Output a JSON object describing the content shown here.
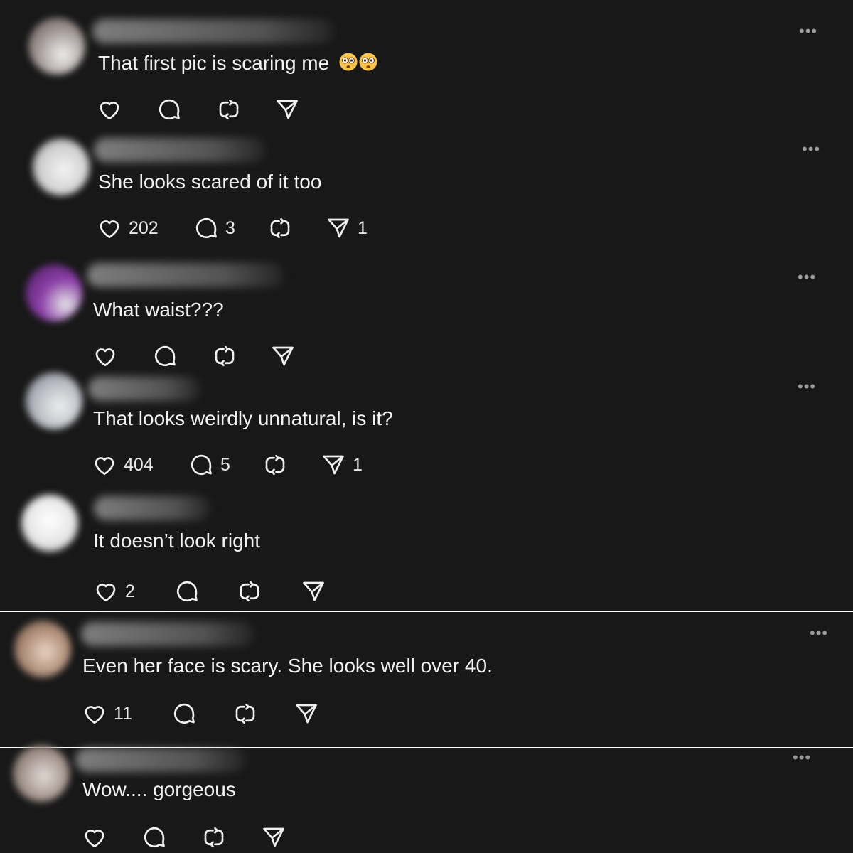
{
  "comments": [
    {
      "text": "That first pic is scaring me",
      "emoji": "flushed-face-emoji-pair",
      "likes": "",
      "replies": "",
      "shares": "",
      "avatar_color": "#9a8f8c"
    },
    {
      "text": "She looks scared of it too",
      "likes": "202",
      "replies": "3",
      "shares": "1",
      "avatar_color": "#cfcfcf"
    },
    {
      "text": "What waist???",
      "likes": "",
      "replies": "",
      "shares": "",
      "avatar_color": "#8a3da6"
    },
    {
      "text": "That looks weirdly unnatural, is it?",
      "likes": "404",
      "replies": "5",
      "shares": "1",
      "avatar_color": "#b9bcc4"
    },
    {
      "text": "It doesn’t look right",
      "likes": "2",
      "replies": "",
      "shares": "",
      "avatar_color": "#e6e6e6"
    },
    {
      "text": "Even her face is scary. She looks well over 40.",
      "likes": "11",
      "replies": "",
      "shares": "",
      "avatar_color": "#b08f7a"
    },
    {
      "text": "Wow.... gorgeous",
      "likes": "",
      "replies": "",
      "shares": "",
      "avatar_color": "#a6968f"
    }
  ],
  "icons": {
    "like": "heart-icon",
    "reply": "comment-bubble-icon",
    "repost": "repost-icon",
    "share": "send-icon",
    "menu": "more-options-icon"
  },
  "menu_glyph": "•••",
  "colors": {
    "background": "#181818",
    "text": "#f2f2f2",
    "muted": "#9a9a9a"
  }
}
